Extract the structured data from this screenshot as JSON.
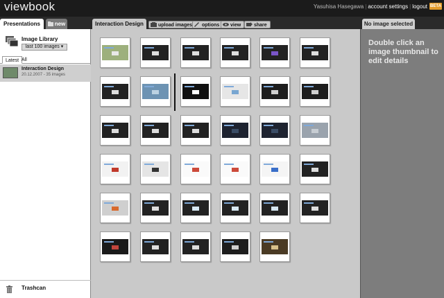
{
  "app": {
    "logo": "viewbook",
    "user_name": "Yasuhisa Hasegawa",
    "account_settings": "account settings",
    "logout": "logout",
    "beta": "BETA"
  },
  "tabs": {
    "presentations": "Presentations",
    "new": "new",
    "current": "Interaction Design",
    "right_panel": "No image selected"
  },
  "toolbar": {
    "upload": "upload images",
    "options": "options",
    "view": "view",
    "share": "share"
  },
  "sidebar": {
    "library_title": "Image Library",
    "library_filter": "last 100 images ▾",
    "filters": [
      "Latest",
      "All"
    ],
    "presentation": {
      "name": "Interaction Design",
      "meta": "20.12.2007 - 35 images"
    },
    "trash": "Trashcan"
  },
  "panel": {
    "message": "Double click an image thumbnail to edit details"
  },
  "colors": {
    "beta_badge": "#e39b2b",
    "topbar": "#1b1b1b",
    "main_bg": "#c9c9c9",
    "panel_bg": "#7d7d7d"
  },
  "thumbnails": [
    {
      "kind": "photo-building"
    },
    {
      "kind": "dark-slide"
    },
    {
      "kind": "dark-slide"
    },
    {
      "kind": "dark-slide"
    },
    {
      "kind": "dark-slide-purple"
    },
    {
      "kind": "dark-slide"
    },
    {
      "kind": "dark-slide"
    },
    {
      "kind": "photo-water"
    },
    {
      "kind": "dark-slide-cursor"
    },
    {
      "kind": "light-cards"
    },
    {
      "kind": "dark-figures"
    },
    {
      "kind": "dark-figures"
    },
    {
      "kind": "dark-slide"
    },
    {
      "kind": "dark-slide"
    },
    {
      "kind": "dark-slide"
    },
    {
      "kind": "dark-photo"
    },
    {
      "kind": "dark-photo"
    },
    {
      "kind": "faded-photo"
    },
    {
      "kind": "web-page"
    },
    {
      "kind": "web-page-dark"
    },
    {
      "kind": "web-page-light"
    },
    {
      "kind": "web-page-light"
    },
    {
      "kind": "web-page-blue"
    },
    {
      "kind": "dark-slide"
    },
    {
      "kind": "photo-person"
    },
    {
      "kind": "dark-slide"
    },
    {
      "kind": "dark-cross"
    },
    {
      "kind": "dark-cross"
    },
    {
      "kind": "dark-cross"
    },
    {
      "kind": "dark-slide"
    },
    {
      "kind": "dark-venn"
    },
    {
      "kind": "dark-slide"
    },
    {
      "kind": "dark-slide"
    },
    {
      "kind": "dark-figures-small"
    },
    {
      "kind": "photo-people"
    }
  ]
}
